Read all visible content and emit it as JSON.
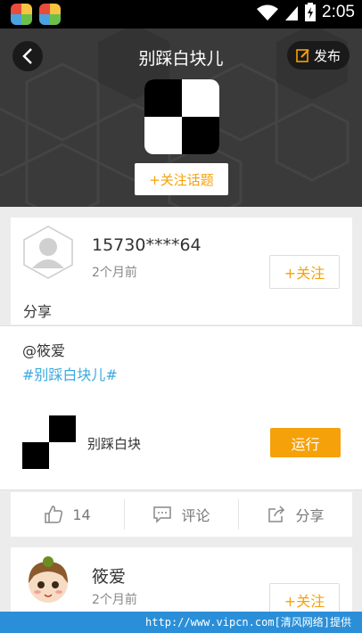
{
  "status_bar": {
    "time": "2:05"
  },
  "header": {
    "title": "别踩白块儿",
    "publish_label": "发布",
    "follow_topic_label": "+关注话题"
  },
  "posts": [
    {
      "username": "15730****64",
      "time": "2个月前",
      "follow_label": "+关注",
      "share_label": "分享",
      "mention": "@筱爱",
      "hashtag": "#别踩白块儿#",
      "game_name": "别踩白块",
      "run_label": "运行",
      "actions": {
        "like_count": "14",
        "comment_label": "评论",
        "share_label": "分享"
      }
    },
    {
      "username": "筱爱",
      "time": "2个月前",
      "follow_label": "+关注"
    }
  ],
  "watermark": "http://www.vipcn.com[清风网络]提供",
  "colors": {
    "accent": "#f5a10a",
    "link": "#3aa9e0",
    "header_bg": "#3a3a3a"
  }
}
